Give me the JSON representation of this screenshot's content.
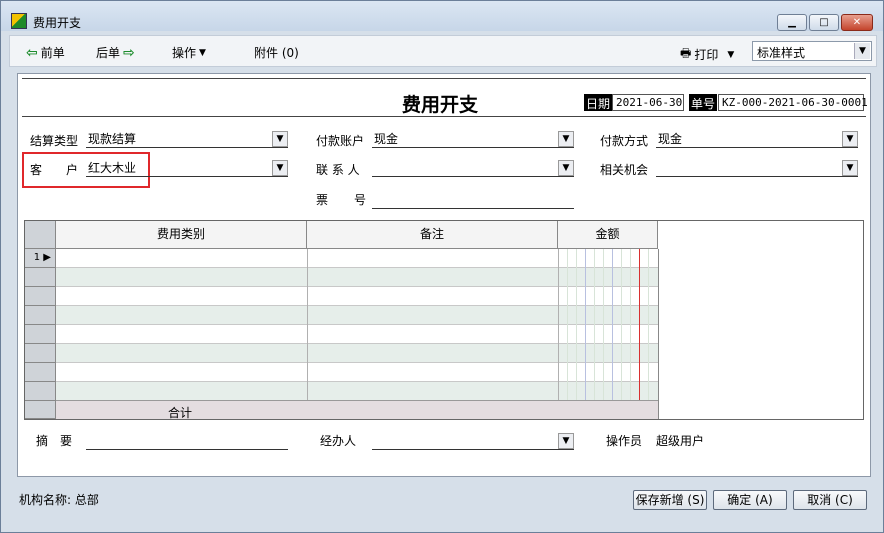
{
  "window": {
    "title": "费用开支"
  },
  "toolbar": {
    "prev": "前单",
    "next": "后单",
    "ops": "操作",
    "attach": "附件 (0)",
    "print": "打印",
    "style_value": "标准样式"
  },
  "header": {
    "title": "费用开支",
    "date_label": "日期",
    "date_value": "2021-06-30",
    "no_label": "单号",
    "no_value": "KZ-000-2021-06-30-0001"
  },
  "fields": {
    "settle_type_label": "结算类型",
    "settle_type_value": "现款结算",
    "customer_label_1": "客",
    "customer_label_2": "户",
    "customer_value": "红大木业",
    "pay_account_label": "付款账户",
    "pay_account_value": "现金",
    "contact_label": "联 系 人",
    "contact_value": "",
    "ticket_label_1": "票",
    "ticket_label_2": "号",
    "ticket_value": "",
    "pay_method_label": "付款方式",
    "pay_method_value": "现金",
    "opportunity_label": "相关机会",
    "opportunity_value": ""
  },
  "grid": {
    "columns": [
      "费用类别",
      "备注",
      "金额"
    ],
    "row1_index": "1",
    "total_label": "合计"
  },
  "bottom": {
    "summary_label_1": "摘",
    "summary_label_2": "要",
    "handler_label": "经办人",
    "operator_label": "操作员",
    "operator_value": "超级用户"
  },
  "status": {
    "org_label": "机构名称: 总部"
  },
  "buttons": {
    "save_new": "保存新增 (S)",
    "ok": "确定 (A)",
    "cancel": "取消 (C)"
  }
}
